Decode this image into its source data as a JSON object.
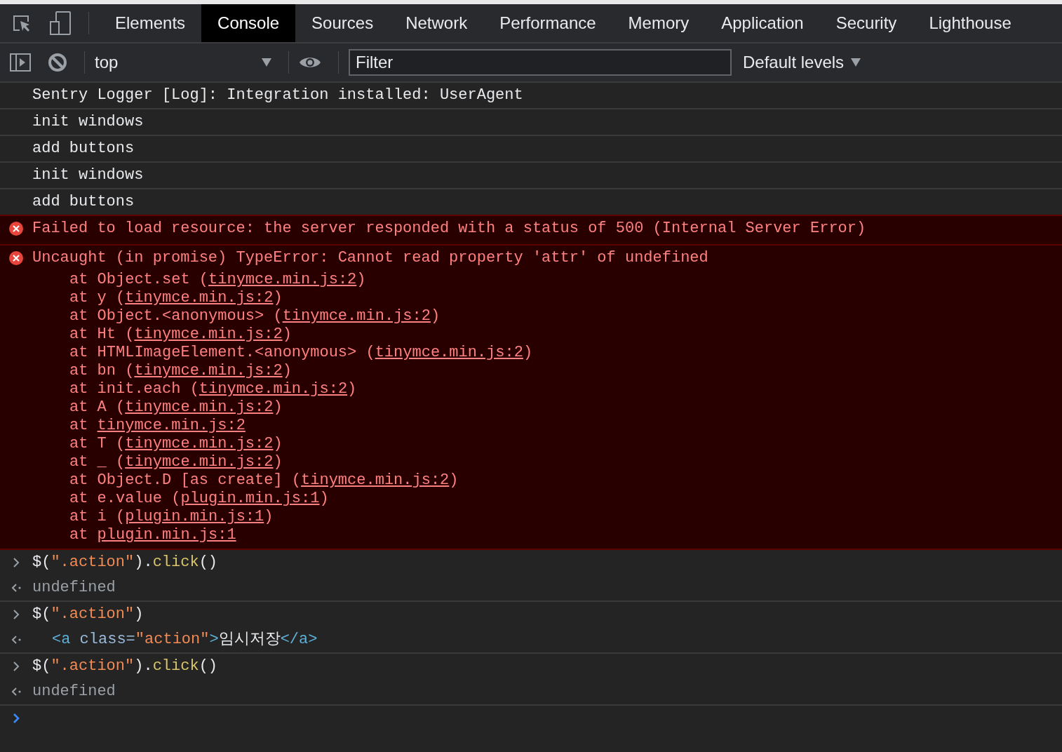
{
  "tabs": [
    {
      "label": "Elements",
      "selected": false
    },
    {
      "label": "Console",
      "selected": true
    },
    {
      "label": "Sources",
      "selected": false
    },
    {
      "label": "Network",
      "selected": false
    },
    {
      "label": "Performance",
      "selected": false
    },
    {
      "label": "Memory",
      "selected": false
    },
    {
      "label": "Application",
      "selected": false
    },
    {
      "label": "Security",
      "selected": false
    },
    {
      "label": "Lighthouse",
      "selected": false
    }
  ],
  "toolbar": {
    "context": "top",
    "filter": {
      "placeholder": "Filter"
    },
    "levels": "Default levels"
  },
  "messages": [
    {
      "kind": "log",
      "text": "Sentry Logger [Log]: Integration installed: UserAgent"
    },
    {
      "kind": "log",
      "text": "init windows"
    },
    {
      "kind": "log",
      "text": "add buttons"
    },
    {
      "kind": "log",
      "text": "init windows"
    },
    {
      "kind": "log",
      "text": "add buttons"
    },
    {
      "kind": "error",
      "text": "Failed to load resource: the server responded with a status of 500 (Internal Server Error)"
    },
    {
      "kind": "error",
      "text": "Uncaught (in promise) TypeError: Cannot read property 'attr' of undefined",
      "stack": [
        {
          "prefix": "at Object.set (",
          "link": "tinymce.min.js:2",
          "suffix": ")"
        },
        {
          "prefix": "at y (",
          "link": "tinymce.min.js:2",
          "suffix": ")"
        },
        {
          "prefix": "at Object.<anonymous> (",
          "link": "tinymce.min.js:2",
          "suffix": ")"
        },
        {
          "prefix": "at Ht (",
          "link": "tinymce.min.js:2",
          "suffix": ")"
        },
        {
          "prefix": "at HTMLImageElement.<anonymous> (",
          "link": "tinymce.min.js:2",
          "suffix": ")"
        },
        {
          "prefix": "at bn (",
          "link": "tinymce.min.js:2",
          "suffix": ")"
        },
        {
          "prefix": "at init.each (",
          "link": "tinymce.min.js:2",
          "suffix": ")"
        },
        {
          "prefix": "at A (",
          "link": "tinymce.min.js:2",
          "suffix": ")"
        },
        {
          "prefix": "at ",
          "link": "tinymce.min.js:2"
        },
        {
          "prefix": "at T (",
          "link": "tinymce.min.js:2",
          "suffix": ")"
        },
        {
          "prefix": "at _ (",
          "link": "tinymce.min.js:2",
          "suffix": ")"
        },
        {
          "prefix": "at Object.D [as create] (",
          "link": "tinymce.min.js:2",
          "suffix": ")"
        },
        {
          "prefix": "at e.value (",
          "link": "plugin.min.js:1",
          "suffix": ")"
        },
        {
          "prefix": "at i (",
          "link": "plugin.min.js:1",
          "suffix": ")"
        },
        {
          "prefix": "at ",
          "link": "plugin.min.js:1"
        }
      ]
    },
    {
      "kind": "input",
      "segments": [
        {
          "kind": "plain",
          "text": "$("
        },
        {
          "kind": "string",
          "text": "\".action\""
        },
        {
          "kind": "plain",
          "text": ")."
        },
        {
          "kind": "method",
          "text": "click"
        },
        {
          "kind": "plain",
          "text": "()"
        }
      ]
    },
    {
      "kind": "result",
      "text": "undefined"
    },
    {
      "kind": "input",
      "segments": [
        {
          "kind": "plain",
          "text": "$("
        },
        {
          "kind": "string",
          "text": "\".action\""
        },
        {
          "kind": "plain",
          "text": ")"
        }
      ]
    },
    {
      "kind": "element",
      "segments": [
        {
          "kind": "tag",
          "text": "<a"
        },
        {
          "kind": "attr",
          "text": " class="
        },
        {
          "kind": "string",
          "text": "\"action\""
        },
        {
          "kind": "tag",
          "text": ">"
        },
        {
          "kind": "plain",
          "text": "임시저장"
        },
        {
          "kind": "tag",
          "text": "</a>"
        }
      ]
    },
    {
      "kind": "input",
      "segments": [
        {
          "kind": "plain",
          "text": "$("
        },
        {
          "kind": "string",
          "text": "\".action\""
        },
        {
          "kind": "plain",
          "text": ")."
        },
        {
          "kind": "method",
          "text": "click"
        },
        {
          "kind": "plain",
          "text": "()"
        }
      ]
    },
    {
      "kind": "result",
      "text": "undefined"
    }
  ]
}
